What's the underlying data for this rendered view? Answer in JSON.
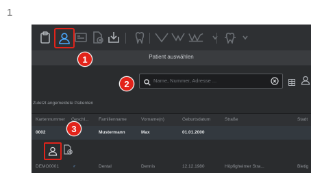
{
  "step_number": "1",
  "dialog": {
    "title": "Patient auswählen"
  },
  "search": {
    "placeholder": "Name, Nummer, Adresse ..."
  },
  "recent_label": "Zuletzt angemeldete Patienten",
  "table": {
    "columns": [
      "Kartennummer",
      "Geschl...",
      "Familienname",
      "Vorname(n)",
      "Geburtsdatum",
      "Straße",
      "Stadt"
    ],
    "rows": [
      {
        "card": "0002",
        "gender": "♂",
        "last": "Mustermann",
        "first": "Max",
        "birth": "01.01.2000",
        "street": "",
        "city": ""
      },
      {
        "card": "DEMO0001",
        "gender": "♂",
        "last": "Dental",
        "first": "Dennis",
        "birth": "12.12.1980",
        "street": "Höpfigheimer Stra...",
        "city": "Bietig"
      }
    ]
  },
  "callouts": [
    "1",
    "2",
    "3"
  ],
  "colors": {
    "accent_red": "#e2231a",
    "active_blue": "#4aa9ff"
  },
  "icons": [
    "clipboard-icon",
    "patient-user-icon",
    "id-card-icon",
    "document-cross-icon",
    "import-icon",
    "tooth-icon",
    "jaw-icon",
    "search-icon",
    "clear-icon",
    "grid-icon",
    "user-icon"
  ]
}
